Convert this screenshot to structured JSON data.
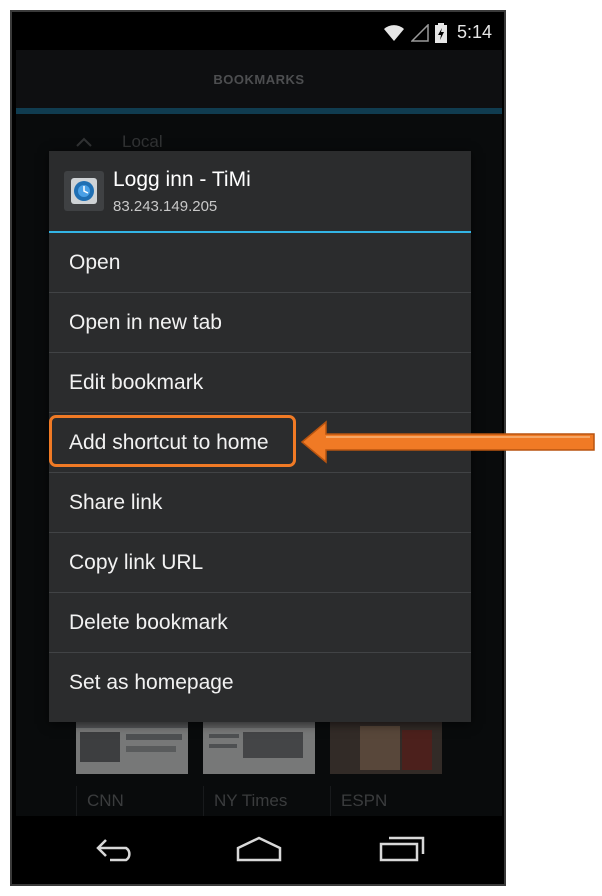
{
  "status_bar": {
    "time": "5:14"
  },
  "action_bar": {
    "title": "BOOKMARKS"
  },
  "folder": {
    "label": "Local"
  },
  "thumbnails": [
    {
      "label": "CNN"
    },
    {
      "label": "NY Times"
    },
    {
      "label": "ESPN"
    }
  ],
  "dialog": {
    "title": "Logg inn - TiMi",
    "subtitle": "83.243.149.205",
    "items": [
      {
        "label": "Open"
      },
      {
        "label": "Open in new tab"
      },
      {
        "label": "Edit bookmark"
      },
      {
        "label": "Add shortcut to home"
      },
      {
        "label": "Share link"
      },
      {
        "label": "Copy link URL"
      },
      {
        "label": "Delete bookmark"
      },
      {
        "label": "Set as homepage"
      }
    ]
  },
  "colors": {
    "accent": "#33b5e5",
    "annotation": "#f07a25",
    "dialog_bg": "#2b2c2d"
  },
  "icons": [
    "wifi-icon",
    "signal-icon",
    "battery-icon",
    "chevron-up-icon",
    "back-icon",
    "home-icon",
    "recents-icon",
    "timi-app-icon"
  ]
}
